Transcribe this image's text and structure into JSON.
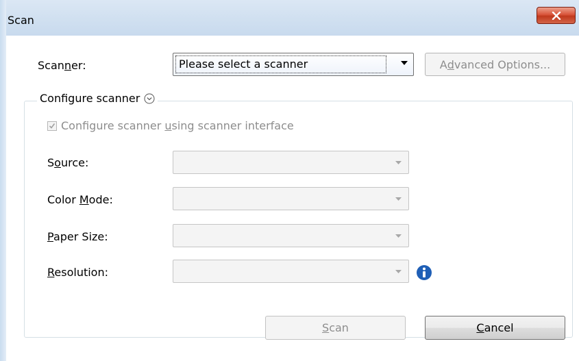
{
  "window": {
    "title": "Scan",
    "close_icon": "close-x-icon"
  },
  "scanner": {
    "label_pre": "Scan",
    "label_key": "n",
    "label_post": "er:",
    "selected_value": "Please select a scanner",
    "advanced_pre": "A",
    "advanced_key": "d",
    "advanced_post": "vanced Options..."
  },
  "configure": {
    "group_label": "Configure scanner",
    "checkbox_pre": "Configure scanner ",
    "checkbox_key": "u",
    "checkbox_post": "sing scanner interface",
    "checkbox_checked": true,
    "checkbox_enabled": false
  },
  "fields": {
    "source": {
      "pre": "S",
      "key": "o",
      "post": "urce:"
    },
    "color_mode": {
      "pre": "Color ",
      "key": "M",
      "post": "ode:"
    },
    "paper_size": {
      "pre": "",
      "key": "P",
      "post": "aper Size:"
    },
    "resolution": {
      "pre": "",
      "key": "R",
      "post": "esolution:"
    }
  },
  "buttons": {
    "scan_pre": "",
    "scan_key": "S",
    "scan_post": "can",
    "cancel_pre": "",
    "cancel_key": "C",
    "cancel_post": "ancel"
  },
  "colors": {
    "disabled_text": "#8d8d8d",
    "info_blue": "#1f5fb6",
    "close_red": "#c7432b"
  }
}
